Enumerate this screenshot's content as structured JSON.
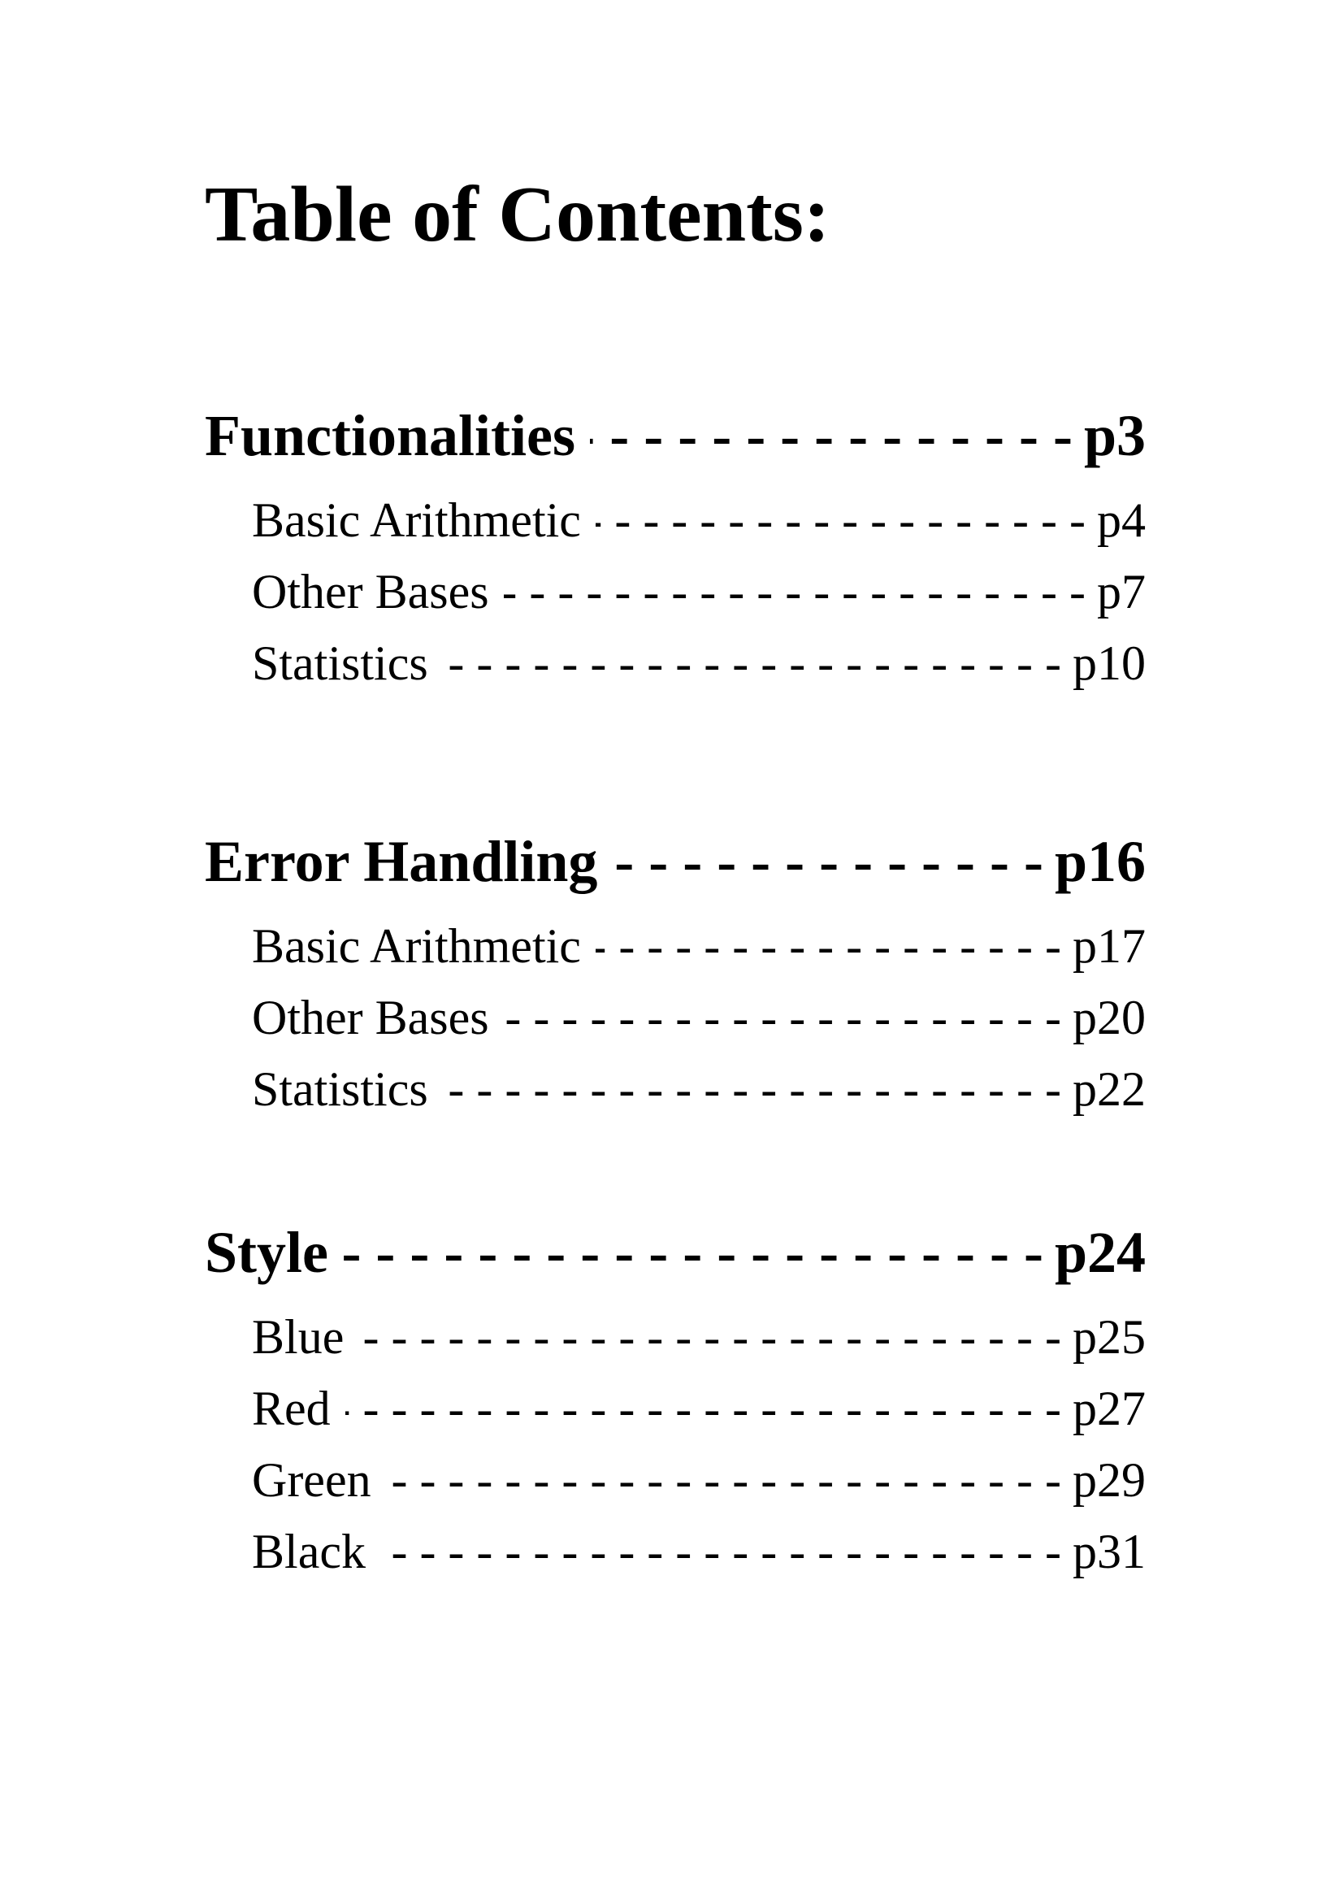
{
  "title": "Table of Contents:",
  "leader": "- - - - - - - - - - - - - - - - - - - - - - - - - - - - - - - - - - - - - - - - - - - - - - - - - - - -",
  "sections": [
    {
      "label": "Functionalities",
      "page": "p3",
      "items": [
        {
          "label": "Basic Arithmetic",
          "page": "p4"
        },
        {
          "label": "Other Bases",
          "page": "p7"
        },
        {
          "label": "Statistics",
          "page": "p10"
        }
      ]
    },
    {
      "label": "Error Handling",
      "page": "p16",
      "items": [
        {
          "label": "Basic Arithmetic",
          "page": "p17"
        },
        {
          "label": "Other Bases",
          "page": "p20"
        },
        {
          "label": "Statistics",
          "page": "p22"
        }
      ]
    },
    {
      "label": "Style",
      "page": "p24",
      "items": [
        {
          "label": "Blue",
          "page": "p25"
        },
        {
          "label": "Red",
          "page": "p27"
        },
        {
          "label": "Green",
          "page": "p29"
        },
        {
          "label": "Black",
          "page": "p31"
        }
      ]
    }
  ]
}
